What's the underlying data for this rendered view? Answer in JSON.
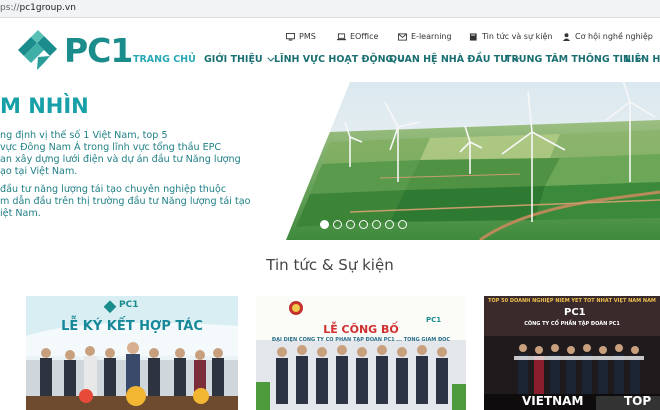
{
  "browser": {
    "url_scheme": "ps://",
    "url_host": "pc1group.vn"
  },
  "brand": {
    "name": "PC1",
    "color": "#1a8c8c"
  },
  "utility_links": [
    {
      "label": "PMS",
      "icon": "monitor-icon"
    },
    {
      "label": "EOffice",
      "icon": "laptop-icon"
    },
    {
      "label": "E-learning",
      "icon": "mail-icon"
    },
    {
      "label": "Tin tức và sự kiện",
      "icon": "book-icon"
    },
    {
      "label": "Cơ hội nghề nghiệp",
      "icon": "user-icon"
    }
  ],
  "nav": [
    {
      "label": "TRANG CHỦ",
      "active": true
    },
    {
      "label": "GIỚI THIỆU",
      "dropdown": true
    },
    {
      "label": "LĨNH VỰC HOẠT ĐỘNG",
      "dropdown": true
    },
    {
      "label": "QUAN HỆ NHÀ ĐẦU TƯ",
      "dropdown": true
    },
    {
      "label": "TRUNG TÂM THÔNG TIN",
      "dropdown": true
    },
    {
      "label": "LIÊN HỆ"
    }
  ],
  "hero": {
    "title": "M NHÌN",
    "lines": [
      "ng định vị thế số 1 Việt Nam, top 5",
      "vực Đông Nam Á trong lĩnh vực tổng thầu EPC",
      "an xây dựng lưới điện và dự án đầu tư Năng lượng",
      "ạo tại Việt Nam.",
      "đầu tư năng lượng tái tạo chuyên nghiệp thuộc",
      "m dẫn đầu trên thị trường đầu tư Năng lượng tái tạo",
      "iệt Nam."
    ],
    "slides_total": 7,
    "slide_active": 1
  },
  "news": {
    "title": "Tin tức & Sự kiện",
    "cards": [
      {
        "logo": "PC1",
        "headline": "LỄ KÝ KẾT HỢP TÁC"
      },
      {
        "logo": "PC1",
        "headline": "LỄ CÔNG BỐ",
        "sub": "ĐẠI DIỆN CÔNG TY CỔ PHẦN TẬP ĐOÀN PC1 ... TỔNG GIÁM ĐỐC"
      },
      {
        "top": "TOP 50 DOANH NGHIỆP NIÊM YẾT TỐT NHẤT VIỆT NAM NĂM",
        "logo": "PC1",
        "company": "CÔNG TY CỔ PHẦN TẬP ĐOÀN PC1",
        "banner_left": "VIETNAM",
        "banner_right": "TOP"
      }
    ]
  }
}
